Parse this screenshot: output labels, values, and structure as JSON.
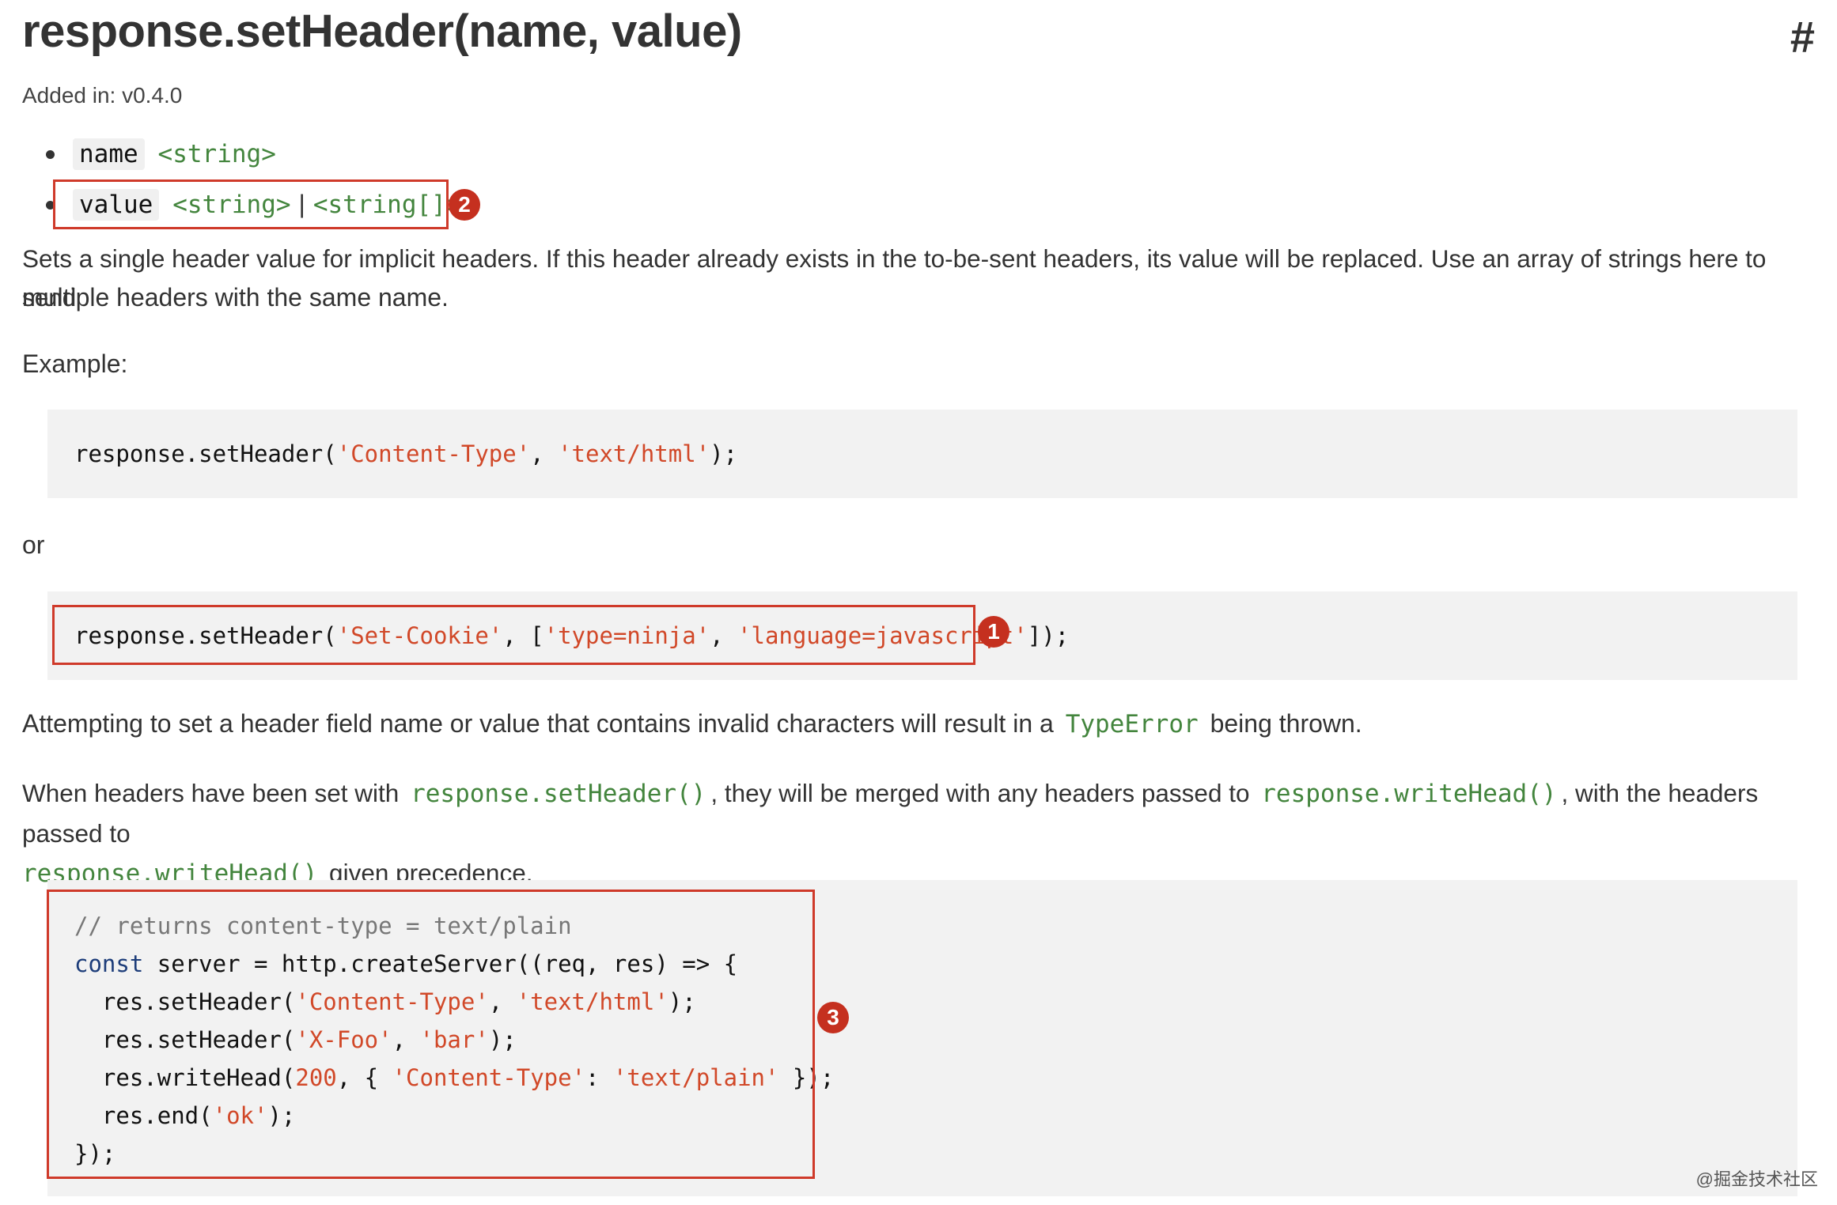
{
  "header": {
    "title": "response.setHeader(name, value)",
    "anchor": "#",
    "added_in": "Added in: v0.4.0"
  },
  "params": [
    {
      "name": "name",
      "types": [
        "<string>"
      ]
    },
    {
      "name": "value",
      "types": [
        "<string>",
        "<string[]>"
      ],
      "separator": "|"
    }
  ],
  "description": {
    "line1": "Sets a single header value for implicit headers. If this header already exists in the to-be-sent headers, its value will be replaced. Use an array of strings here to send",
    "line2": "multiple headers with the same name."
  },
  "example_label": "Example:",
  "example1": {
    "prefix": "response.setHeader(",
    "arg1": "'Content-Type'",
    "comma": ", ",
    "arg2": "'text/html'",
    "suffix": ");"
  },
  "or_label": "or",
  "example2": {
    "prefix": "response.setHeader(",
    "arg1": "'Set-Cookie'",
    "mid": ", [",
    "arg2": "'type=ninja'",
    "comma": ", ",
    "arg3": "'language=javascript'",
    "suffix": "]);"
  },
  "error_para": {
    "before": "Attempting to set a header field name or value that contains invalid characters will result in a",
    "code": "TypeError",
    "after": "being thrown."
  },
  "merge_para": {
    "t1": "When headers have been set with",
    "c1": "response.setHeader()",
    "t2": ", they will be merged with any headers passed to",
    "c2": "response.writeHead()",
    "t3": ", with the headers passed to",
    "c3": "response.writeHead()",
    "t4": "given precedence."
  },
  "example3": {
    "comment": "// returns content-type = text/plain",
    "l2_kw": "const",
    "l2_rest": " server = http.createServer((req, res) => {",
    "l3_pre": "  res.setHeader(",
    "l3_a": "'Content-Type'",
    "l3_c": ", ",
    "l3_b": "'text/html'",
    "l3_end": ");",
    "l4_pre": "  res.setHeader(",
    "l4_a": "'X-Foo'",
    "l4_c": ", ",
    "l4_b": "'bar'",
    "l4_end": ");",
    "l5_pre": "  res.writeHead(",
    "l5_num": "200",
    "l5_mid": ", { ",
    "l5_a": "'Content-Type'",
    "l5_c": ": ",
    "l5_b": "'text/plain'",
    "l5_end": " });",
    "l6_pre": "  res.end(",
    "l6_a": "'ok'",
    "l6_end": ");",
    "l7": "});"
  },
  "markers": {
    "m1": "1",
    "m2": "2",
    "m3": "3"
  },
  "watermark": "@掘金技术社区",
  "colors": {
    "highlight": "#cf3a2a",
    "type_green": "#43853d",
    "string_red": "#d14828"
  }
}
